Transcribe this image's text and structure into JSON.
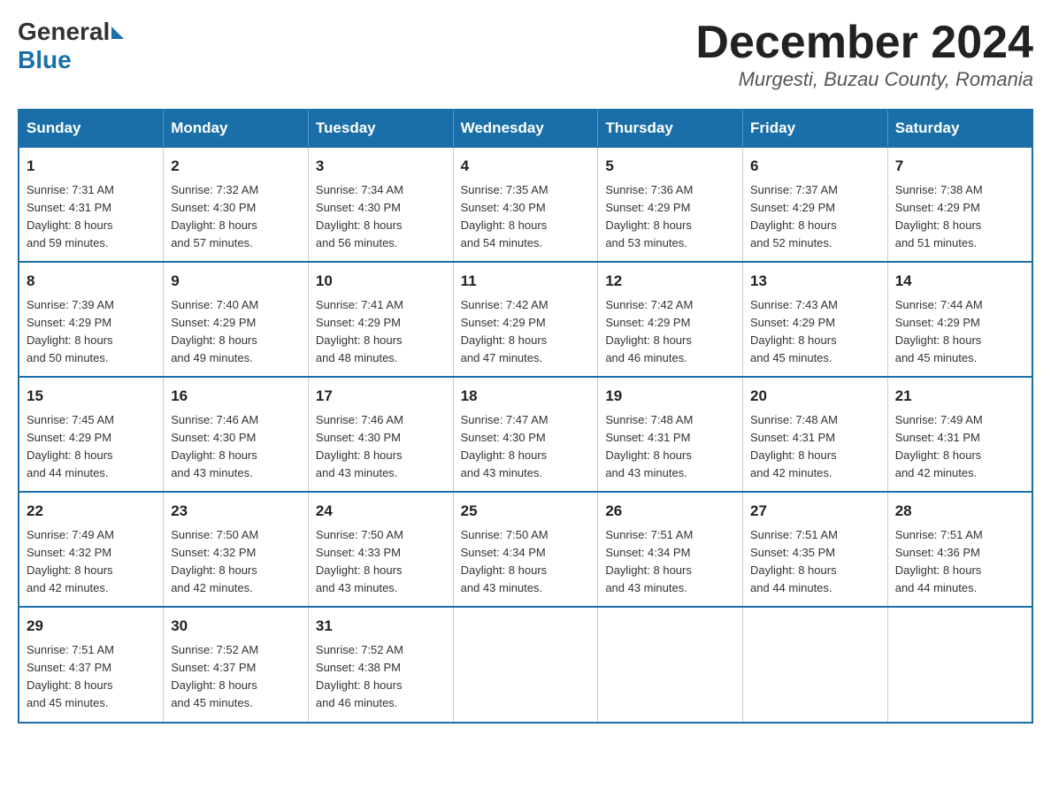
{
  "header": {
    "logo_general": "General",
    "logo_blue": "Blue",
    "month_year": "December 2024",
    "location": "Murgesti, Buzau County, Romania"
  },
  "days_of_week": [
    "Sunday",
    "Monday",
    "Tuesday",
    "Wednesday",
    "Thursday",
    "Friday",
    "Saturday"
  ],
  "weeks": [
    [
      {
        "day": "1",
        "sunrise": "7:31 AM",
        "sunset": "4:31 PM",
        "daylight": "8 hours and 59 minutes."
      },
      {
        "day": "2",
        "sunrise": "7:32 AM",
        "sunset": "4:30 PM",
        "daylight": "8 hours and 57 minutes."
      },
      {
        "day": "3",
        "sunrise": "7:34 AM",
        "sunset": "4:30 PM",
        "daylight": "8 hours and 56 minutes."
      },
      {
        "day": "4",
        "sunrise": "7:35 AM",
        "sunset": "4:30 PM",
        "daylight": "8 hours and 54 minutes."
      },
      {
        "day": "5",
        "sunrise": "7:36 AM",
        "sunset": "4:29 PM",
        "daylight": "8 hours and 53 minutes."
      },
      {
        "day": "6",
        "sunrise": "7:37 AM",
        "sunset": "4:29 PM",
        "daylight": "8 hours and 52 minutes."
      },
      {
        "day": "7",
        "sunrise": "7:38 AM",
        "sunset": "4:29 PM",
        "daylight": "8 hours and 51 minutes."
      }
    ],
    [
      {
        "day": "8",
        "sunrise": "7:39 AM",
        "sunset": "4:29 PM",
        "daylight": "8 hours and 50 minutes."
      },
      {
        "day": "9",
        "sunrise": "7:40 AM",
        "sunset": "4:29 PM",
        "daylight": "8 hours and 49 minutes."
      },
      {
        "day": "10",
        "sunrise": "7:41 AM",
        "sunset": "4:29 PM",
        "daylight": "8 hours and 48 minutes."
      },
      {
        "day": "11",
        "sunrise": "7:42 AM",
        "sunset": "4:29 PM",
        "daylight": "8 hours and 47 minutes."
      },
      {
        "day": "12",
        "sunrise": "7:42 AM",
        "sunset": "4:29 PM",
        "daylight": "8 hours and 46 minutes."
      },
      {
        "day": "13",
        "sunrise": "7:43 AM",
        "sunset": "4:29 PM",
        "daylight": "8 hours and 45 minutes."
      },
      {
        "day": "14",
        "sunrise": "7:44 AM",
        "sunset": "4:29 PM",
        "daylight": "8 hours and 45 minutes."
      }
    ],
    [
      {
        "day": "15",
        "sunrise": "7:45 AM",
        "sunset": "4:29 PM",
        "daylight": "8 hours and 44 minutes."
      },
      {
        "day": "16",
        "sunrise": "7:46 AM",
        "sunset": "4:30 PM",
        "daylight": "8 hours and 43 minutes."
      },
      {
        "day": "17",
        "sunrise": "7:46 AM",
        "sunset": "4:30 PM",
        "daylight": "8 hours and 43 minutes."
      },
      {
        "day": "18",
        "sunrise": "7:47 AM",
        "sunset": "4:30 PM",
        "daylight": "8 hours and 43 minutes."
      },
      {
        "day": "19",
        "sunrise": "7:48 AM",
        "sunset": "4:31 PM",
        "daylight": "8 hours and 43 minutes."
      },
      {
        "day": "20",
        "sunrise": "7:48 AM",
        "sunset": "4:31 PM",
        "daylight": "8 hours and 42 minutes."
      },
      {
        "day": "21",
        "sunrise": "7:49 AM",
        "sunset": "4:31 PM",
        "daylight": "8 hours and 42 minutes."
      }
    ],
    [
      {
        "day": "22",
        "sunrise": "7:49 AM",
        "sunset": "4:32 PM",
        "daylight": "8 hours and 42 minutes."
      },
      {
        "day": "23",
        "sunrise": "7:50 AM",
        "sunset": "4:32 PM",
        "daylight": "8 hours and 42 minutes."
      },
      {
        "day": "24",
        "sunrise": "7:50 AM",
        "sunset": "4:33 PM",
        "daylight": "8 hours and 43 minutes."
      },
      {
        "day": "25",
        "sunrise": "7:50 AM",
        "sunset": "4:34 PM",
        "daylight": "8 hours and 43 minutes."
      },
      {
        "day": "26",
        "sunrise": "7:51 AM",
        "sunset": "4:34 PM",
        "daylight": "8 hours and 43 minutes."
      },
      {
        "day": "27",
        "sunrise": "7:51 AM",
        "sunset": "4:35 PM",
        "daylight": "8 hours and 44 minutes."
      },
      {
        "day": "28",
        "sunrise": "7:51 AM",
        "sunset": "4:36 PM",
        "daylight": "8 hours and 44 minutes."
      }
    ],
    [
      {
        "day": "29",
        "sunrise": "7:51 AM",
        "sunset": "4:37 PM",
        "daylight": "8 hours and 45 minutes."
      },
      {
        "day": "30",
        "sunrise": "7:52 AM",
        "sunset": "4:37 PM",
        "daylight": "8 hours and 45 minutes."
      },
      {
        "day": "31",
        "sunrise": "7:52 AM",
        "sunset": "4:38 PM",
        "daylight": "8 hours and 46 minutes."
      },
      null,
      null,
      null,
      null
    ]
  ],
  "labels": {
    "sunrise": "Sunrise:",
    "sunset": "Sunset:",
    "daylight": "Daylight:"
  }
}
